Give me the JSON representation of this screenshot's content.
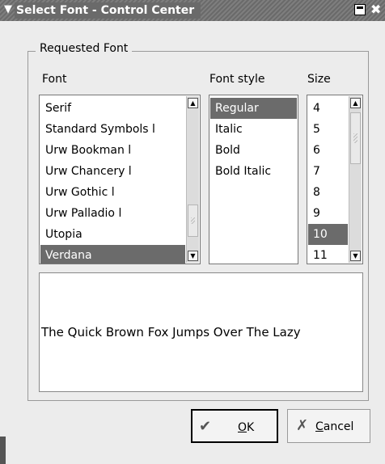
{
  "window": {
    "title": "Select Font - Control Center"
  },
  "group": {
    "label": "Requested Font"
  },
  "columns": {
    "font": "Font",
    "style": "Font style",
    "size": "Size"
  },
  "fonts": [
    {
      "label": "Serif",
      "selected": false
    },
    {
      "label": "Standard Symbols l",
      "selected": false
    },
    {
      "label": "Urw Bookman l",
      "selected": false
    },
    {
      "label": "Urw Chancery l",
      "selected": false
    },
    {
      "label": "Urw Gothic l",
      "selected": false
    },
    {
      "label": "Urw Palladio l",
      "selected": false
    },
    {
      "label": "Utopia",
      "selected": false
    },
    {
      "label": "Verdana",
      "selected": true
    }
  ],
  "styles": [
    {
      "label": "Regular",
      "selected": true
    },
    {
      "label": "Italic",
      "selected": false
    },
    {
      "label": "Bold",
      "selected": false
    },
    {
      "label": "Bold Italic",
      "selected": false
    }
  ],
  "sizes": [
    {
      "label": "4",
      "selected": false
    },
    {
      "label": "5",
      "selected": false
    },
    {
      "label": "6",
      "selected": false
    },
    {
      "label": "7",
      "selected": false
    },
    {
      "label": "8",
      "selected": false
    },
    {
      "label": "9",
      "selected": false
    },
    {
      "label": "10",
      "selected": true
    },
    {
      "label": "11",
      "selected": false
    }
  ],
  "preview": {
    "text": "The Quick Brown Fox Jumps Over The Lazy"
  },
  "buttons": {
    "ok_mnemonic": "O",
    "ok_rest": "K",
    "cancel_mnemonic": "C",
    "cancel_rest": "ancel"
  },
  "colors": {
    "selection": "#6b6b6b",
    "titlebar": "#6a6a6a"
  }
}
